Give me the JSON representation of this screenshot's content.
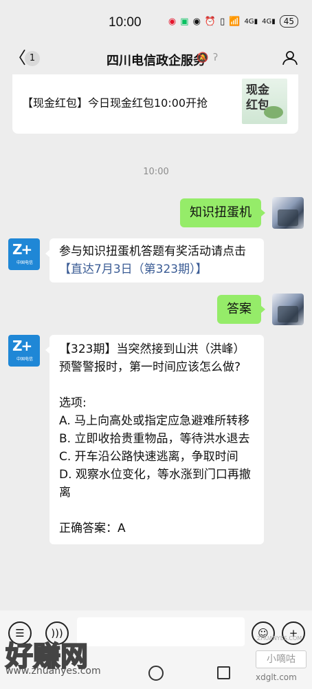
{
  "status": {
    "time": "10:00",
    "battery": "45",
    "net1": "4G",
    "net2": "4G"
  },
  "nav": {
    "back_count": "1",
    "title": "四川电信政企服务"
  },
  "promo": {
    "text": "【现金红包】今日现金红包10:00开抢",
    "thumb_text": "现金\n红包"
  },
  "timestamp": "10:00",
  "messages": [
    {
      "side": "right",
      "text": "知识扭蛋机"
    },
    {
      "side": "left",
      "text": "参与知识扭蛋机答题有奖活动请点击",
      "link": "【直达7月3日（第323期）】"
    },
    {
      "side": "right",
      "text": "答案"
    },
    {
      "side": "left",
      "text": "【323期】当突然接到山洪（洪峰）预警警报时，第一时间应该怎么做?\n\n选项:\nA. 马上向高处或指定应急避难所转移\nB. 立即收拾贵重物品，等待洪水退去\nC. 开车沿公路快速逃离，争取时间\nD. 观察水位变化，等水涨到门口再撤离\n\n正确答案：A"
    }
  ],
  "avatar_left": {
    "mark": "Z+",
    "sub": "中国电信"
  },
  "watermarks": {
    "brand": "好赚网",
    "url": "www.zhuanyes.com",
    "right_label": "小嘀咕",
    "right_url": "xdglt.com",
    "right_tiny": "ZHUANYES.COM"
  }
}
